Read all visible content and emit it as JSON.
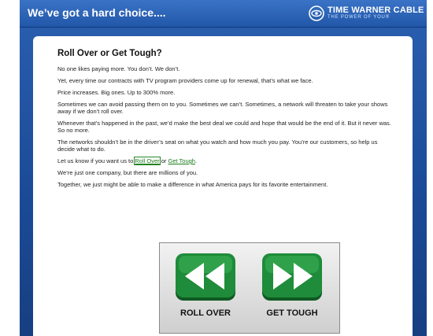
{
  "header": {
    "title": "We’ve got a hard choice....",
    "logo_name": "TIME WARNER CABLE",
    "logo_tagline": "THE POWER OF YOU®"
  },
  "content": {
    "heading": "Roll Over or Get Tough?",
    "p1": "No one likes paying more.  You don’t.  We don’t.",
    "p2": "Yet, every time our contracts with TV program providers come up for renewal, that’s what we face.",
    "p3": "Price increases.  Big ones.  Up to 300% more.",
    "p4": "Sometimes we can avoid passing them on to you.  Sometimes we can’t.  Sometimes, a network will threaten to take your shows away if we don’t roll over.",
    "p5": "Whenever that’s happened in the past, we’d make the best deal we could and hope that would be the end of it.  But it never was.  So no more.",
    "p6": "The networks shouldn’t be in the driver’s seat on what you watch and how much you pay.  You’re our customers, so help us decide what to do.",
    "p7_prefix": "Let us know if you want us to ",
    "p7_link1": "Roll Over",
    "p7_or": " or ",
    "p7_link2": "Get Tough",
    "p7_suffix": ".",
    "p8": "We’re just one company, but there are millions of you.",
    "p9": "Together, we just might be able to make a difference in what America pays for its favorite entertainment."
  },
  "buttons": {
    "roll_over_label": "ROLL OVER",
    "get_tough_label": "GET TOUGH",
    "roll_over_icon": "rewind-icon",
    "get_tough_icon": "fast-forward-icon",
    "button_color": "#1e8c3a"
  },
  "colors": {
    "header_blue": "#2257a8",
    "link_green": "#1a7a1a"
  }
}
